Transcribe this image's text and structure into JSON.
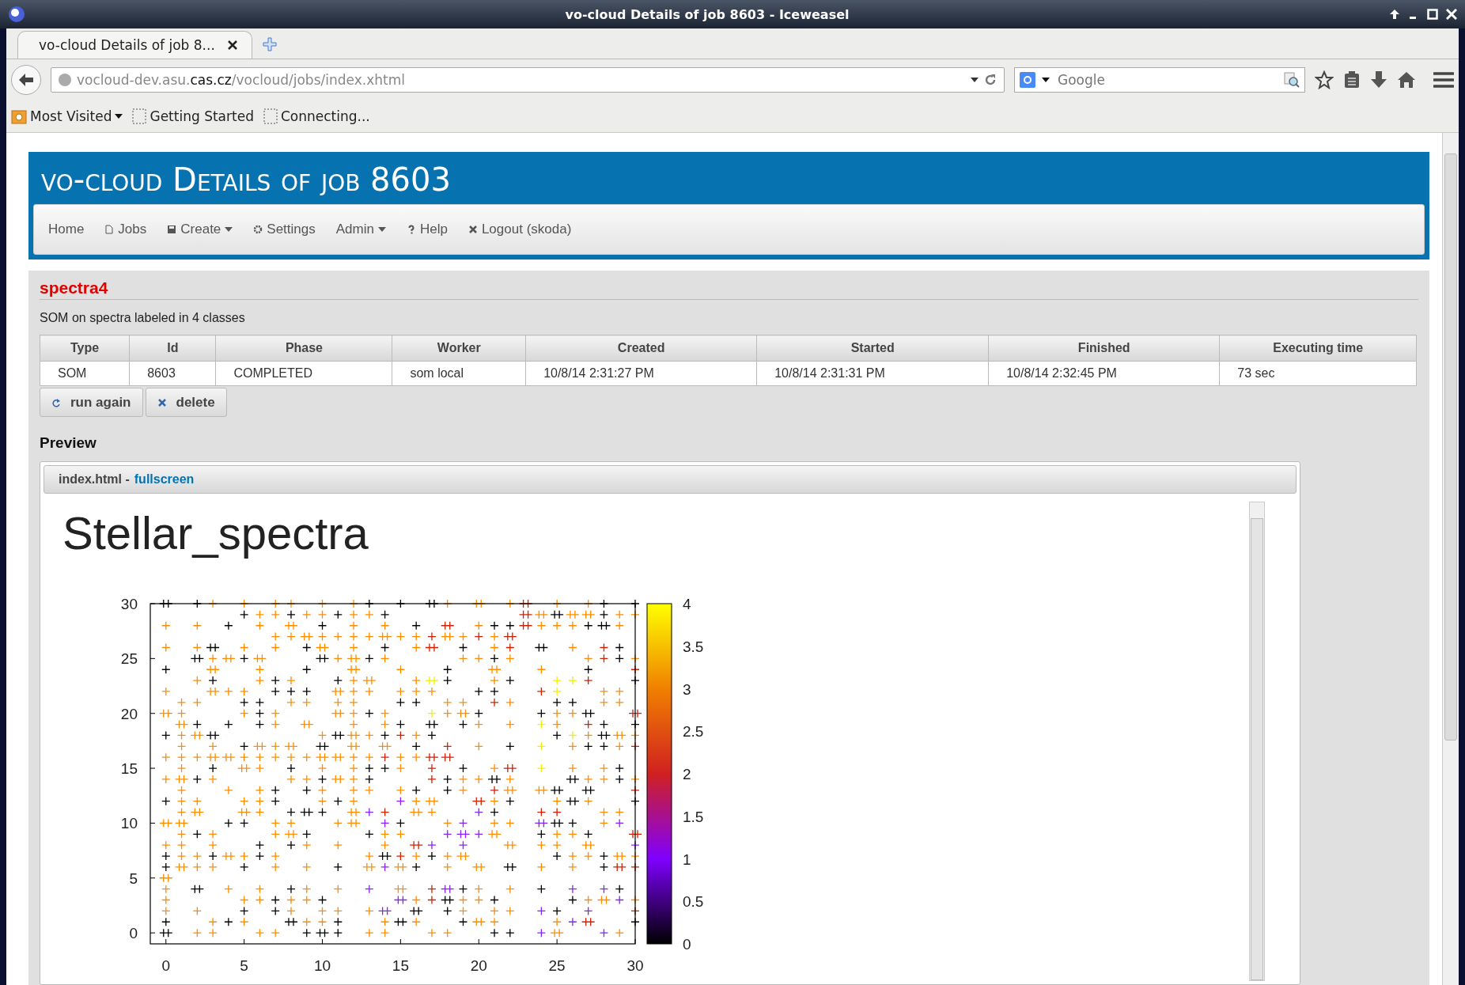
{
  "window": {
    "title": "vo-cloud Details of job 8603 - Iceweasel"
  },
  "tabs": [
    {
      "label": "vo-cloud Details of job 8...",
      "selected": true
    }
  ],
  "address": {
    "host_prefix": "vocloud-dev.asu.",
    "host_domain": "cas.cz",
    "path": "/vocloud/jobs/index.xhtml"
  },
  "search": {
    "placeholder": "Google"
  },
  "bookmarks": [
    {
      "label": "Most Visited",
      "kind": "menu"
    },
    {
      "label": "Getting Started",
      "kind": "page"
    },
    {
      "label": "Connecting...",
      "kind": "page"
    }
  ],
  "page": {
    "title": "vo-cloud Details of job 8603",
    "nav": [
      {
        "label": "Home",
        "dropdown": false
      },
      {
        "label": "Jobs",
        "dropdown": false
      },
      {
        "label": "Create",
        "dropdown": true
      },
      {
        "label": "Settings",
        "dropdown": false
      },
      {
        "label": "Admin",
        "dropdown": true
      },
      {
        "label": "Help",
        "dropdown": false
      },
      {
        "label": "Logout (skoda)",
        "dropdown": false
      }
    ],
    "job": {
      "name": "spectra4",
      "description": "SOM on spectra labeled in 4 classes"
    },
    "table": {
      "columns": [
        "Type",
        "Id",
        "Phase",
        "Worker",
        "Created",
        "Started",
        "Finished",
        "Executing time"
      ],
      "rows": [
        [
          "SOM",
          "8603",
          "COMPLETED",
          "som local",
          "10/8/14 2:31:27 PM",
          "10/8/14 2:31:31 PM",
          "10/8/14 2:32:45 PM",
          "73 sec"
        ]
      ]
    },
    "actions": [
      "run again",
      "delete"
    ],
    "preview": {
      "heading": "Preview",
      "file": "index.html -",
      "link": "fullscreen",
      "plot_title": "Stellar_spectra",
      "plot": {
        "x_ticks": [
          "0",
          "5",
          "10",
          "15",
          "20",
          "25",
          "30"
        ],
        "y_ticks": [
          "30",
          "25",
          "20",
          "15",
          "10",
          "5",
          "0"
        ]
      },
      "colorbar_ticks": [
        "4",
        "3.5",
        "3",
        "2.5",
        "2",
        "1.5",
        "1",
        "0.5",
        "0"
      ]
    }
  }
}
